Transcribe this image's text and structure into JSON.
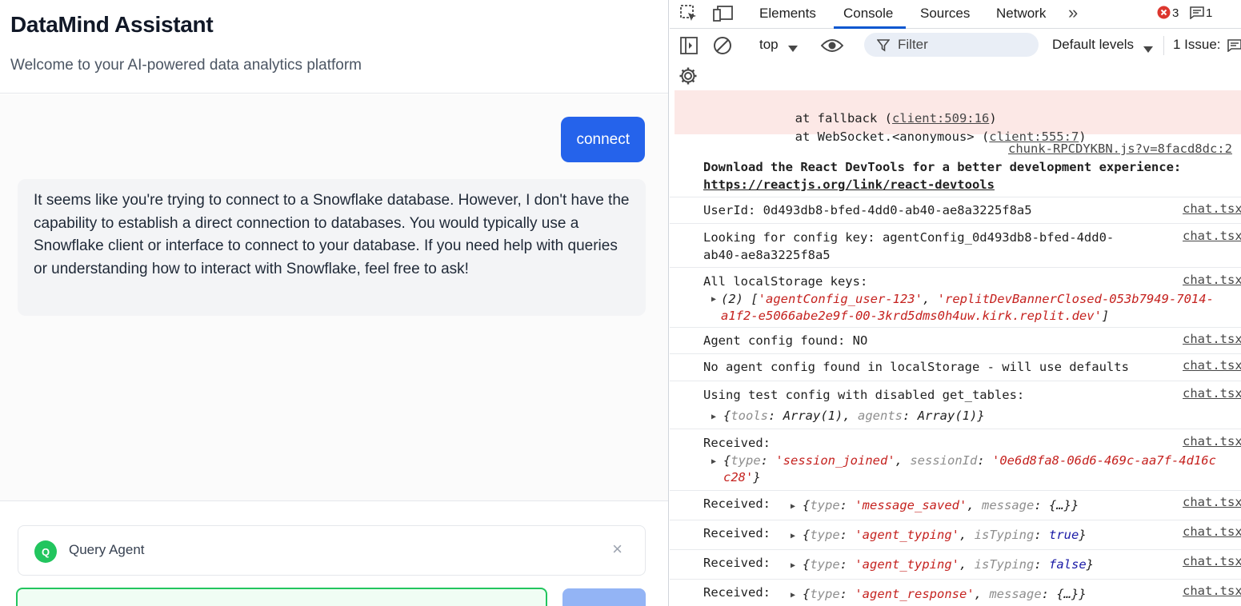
{
  "app": {
    "title": "DataMind Assistant",
    "subtitle": "Welcome to your AI-powered data analytics platform",
    "messages": {
      "user": "connect",
      "assistant": "It seems like you're trying to connect to a Snowflake database. However, I don't have the capability to establish a direct connection to databases. You would typically use a Snowflake client or interface to connect to your database. If you need help with queries or understanding how to interact with Snowflake, feel free to ask!"
    },
    "agent": {
      "badge": "Q",
      "name": "Query Agent",
      "close": "×"
    },
    "colors": {
      "primary": "#2563eb",
      "agent_green": "#22c55e"
    }
  },
  "devtools": {
    "tabs": [
      "Elements",
      "Console",
      "Sources",
      "Network"
    ],
    "more_tabs": "»",
    "error_count": "3",
    "message_count": "1",
    "context": "top",
    "filter_placeholder": "Filter",
    "levels": "Default levels",
    "issues": "1 Issue:",
    "icons": [
      "inspect-icon",
      "device-icon",
      "sidebar-icon",
      "clear-icon",
      "eye-icon",
      "filter-icon",
      "gear-icon"
    ],
    "error_stack": {
      "line1_prefix": "at fallback (",
      "line1_link": "client:509:16",
      "line1_suffix": ")",
      "line2_prefix": "at WebSocket.<anonymous> (",
      "line2_link": "client:555:7",
      "line2_suffix": ")"
    },
    "log": {
      "react_source": "chunk-RPCDYKBN.js?v=8facd8dc:2",
      "react_line1": "Download the React DevTools for a better development experience:",
      "react_line2": "https://reactjs.org/link/react-devtools",
      "chat_source": "chat.tsx",
      "userid": "UserId: 0d493db8-bfed-4dd0-ab40-ae8a3225f8a5",
      "lookup1": "Looking for config key: agentConfig_0d493db8-bfed-4dd0-",
      "lookup2": "ab40-ae8a3225f8a5",
      "keys_label": "All localStorage keys:",
      "keys_count": "(2) [",
      "keys_v1": "'agentConfig_user-123'",
      "keys_sep": ", ",
      "keys_v2a": "'replitDevBannerClosed-053b7949-7014-",
      "keys_v2b": "a1f2-e5066abe2e9f-00-3krd5dms0h4uw.kirk.replit.dev'",
      "keys_close": "]",
      "found": "Agent config found: NO",
      "none": "No agent config found in localStorage - will use defaults",
      "test_label": "Using test config with disabled get_tables:",
      "test_obj_open": "{",
      "test_k1": "tools",
      "test_v1": "Array(1)",
      "test_k2": "agents",
      "test_v2": "Array(1)",
      "test_obj_close": "}",
      "received": "Received:",
      "r1_k1": "type",
      "r1_v1": "'session_joined'",
      "r1_k2": "sessionId",
      "r1_v2a": "'0e6d8fa8-06d6-469c-aa7f-4d16c",
      "r1_v2b": "c28'",
      "r2_v1": "'message_saved'",
      "r2_k2": "message",
      "r2_v2": "{…}",
      "r3_v1": "'agent_typing'",
      "r3_k2": "isTyping",
      "r3_v2": "true",
      "r4_v1": "'agent_typing'",
      "r4_k2": "isTyping",
      "r4_v2": "false",
      "r5_v1": "'agent_response'",
      "r5_k2": "message",
      "r5_v2": "{…}"
    }
  }
}
